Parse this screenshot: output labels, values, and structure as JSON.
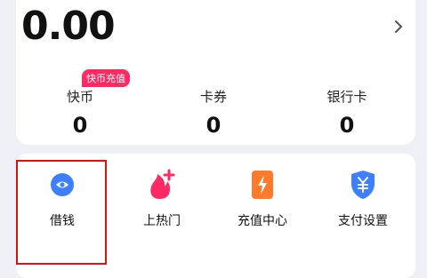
{
  "wallet": {
    "balance": "0.00",
    "stats": [
      {
        "label": "快币",
        "value": "0"
      },
      {
        "label": "卡券",
        "value": "0"
      },
      {
        "label": "银行卡",
        "value": "0"
      }
    ],
    "recharge_badge": "快币充值"
  },
  "services": [
    {
      "label": "借钱",
      "icon": "loan-icon",
      "color": "#3d7fff"
    },
    {
      "label": "上热门",
      "icon": "flame-icon",
      "color": "#ff2a64"
    },
    {
      "label": "充值中心",
      "icon": "recharge-icon",
      "color": "#ff7a2a"
    },
    {
      "label": "支付设置",
      "icon": "payment-shield-icon",
      "color": "#3d7fff"
    }
  ]
}
